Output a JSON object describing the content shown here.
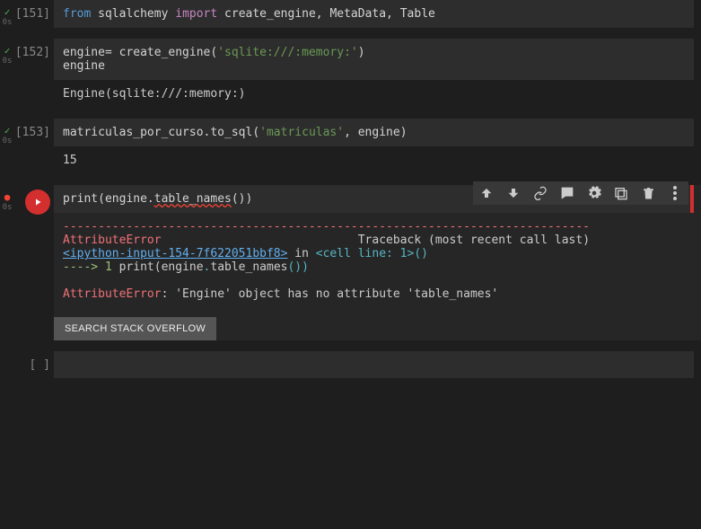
{
  "cells": [
    {
      "exec_count": "[151]",
      "status_time": "0s",
      "code": {
        "tokens": [
          {
            "t": "kw",
            "v": "from"
          },
          {
            "t": "sp",
            "v": " "
          },
          {
            "t": "fn",
            "v": "sqlalchemy"
          },
          {
            "t": "sp",
            "v": " "
          },
          {
            "t": "kw2",
            "v": "import"
          },
          {
            "t": "sp",
            "v": " "
          },
          {
            "t": "fn",
            "v": "create_engine, MetaData, Table"
          }
        ]
      }
    },
    {
      "exec_count": "[152]",
      "status_time": "0s",
      "code_lines": [
        [
          {
            "t": "fn",
            "v": "engine= create_engine("
          },
          {
            "t": "str",
            "v": "'sqlite:///:memory:'"
          },
          {
            "t": "fn",
            "v": ")"
          }
        ],
        [
          {
            "t": "fn",
            "v": "engine"
          }
        ]
      ],
      "output": "Engine(sqlite:///:memory:)"
    },
    {
      "exec_count": "[153]",
      "status_time": "0s",
      "code_lines": [
        [
          {
            "t": "fn",
            "v": "matriculas_por_curso.to_sql("
          },
          {
            "t": "str",
            "v": "'matriculas'"
          },
          {
            "t": "fn",
            "v": ", engine)"
          }
        ]
      ],
      "output": "15"
    }
  ],
  "active_cell": {
    "status_time": "0s",
    "code_tokens": [
      {
        "t": "fn",
        "v": "print(engine."
      },
      {
        "t": "squiggle",
        "v": "table_names"
      },
      {
        "t": "fn",
        "v": "())"
      }
    ],
    "error": {
      "dashes": "---------------------------------------------------------------------------",
      "err_name": "AttributeError",
      "traceback_label": "Traceback (most recent call last)",
      "frame_link": "<ipython-input-154-7f622051bbf8>",
      "in_word": " in ",
      "cell_line": "<cell line: 1>",
      "paren": "()",
      "arrow": "----> ",
      "lineno": "1",
      "call_pre": " print(engine",
      "call_dot": ".",
      "call_method": "table_names",
      "call_end": "())",
      "final_name": "AttributeError",
      "final_msg": ": 'Engine' object has no attribute 'table_names'"
    },
    "so_button": "SEARCH STACK OVERFLOW"
  },
  "empty_prompt": "[ ]",
  "toolbar_icons": {
    "up": "arrow-up-icon",
    "down": "arrow-down-icon",
    "link": "link-icon",
    "comment": "comment-icon",
    "settings": "gear-icon",
    "mirror": "mirror-icon",
    "delete": "trash-icon",
    "more": "more-icon"
  }
}
